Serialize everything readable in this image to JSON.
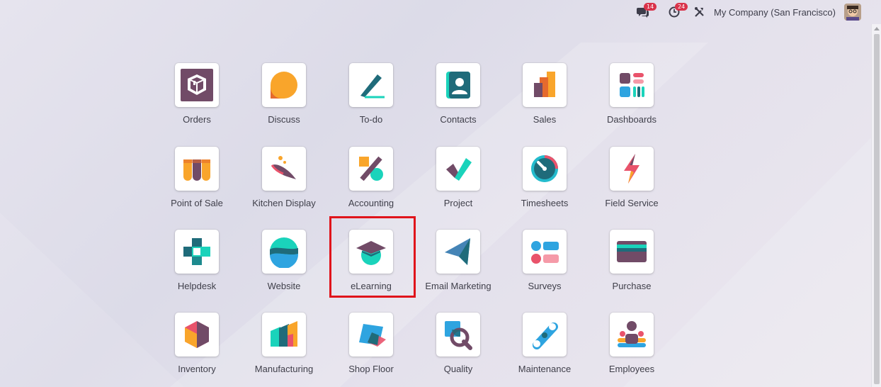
{
  "topbar": {
    "chat_badge": "14",
    "activity_badge": "24",
    "company_name": "My Company (San Francisco)",
    "icons": [
      "chat-icon",
      "activity-clock-icon",
      "debug-tools-icon",
      "user-avatar"
    ]
  },
  "apps": [
    {
      "label": "Orders",
      "icon": "orders-icon"
    },
    {
      "label": "Discuss",
      "icon": "discuss-icon"
    },
    {
      "label": "To-do",
      "icon": "todo-icon"
    },
    {
      "label": "Contacts",
      "icon": "contacts-icon"
    },
    {
      "label": "Sales",
      "icon": "sales-icon"
    },
    {
      "label": "Dashboards",
      "icon": "dashboards-icon"
    },
    {
      "label": "Point of Sale",
      "icon": "point-of-sale-icon"
    },
    {
      "label": "Kitchen Display",
      "icon": "kitchen-display-icon"
    },
    {
      "label": "Accounting",
      "icon": "accounting-icon"
    },
    {
      "label": "Project",
      "icon": "project-icon"
    },
    {
      "label": "Timesheets",
      "icon": "timesheets-icon"
    },
    {
      "label": "Field Service",
      "icon": "field-service-icon"
    },
    {
      "label": "Helpdesk",
      "icon": "helpdesk-icon"
    },
    {
      "label": "Website",
      "icon": "website-icon"
    },
    {
      "label": "eLearning",
      "icon": "elearning-icon"
    },
    {
      "label": "Email Marketing",
      "icon": "email-marketing-icon"
    },
    {
      "label": "Surveys",
      "icon": "surveys-icon"
    },
    {
      "label": "Purchase",
      "icon": "purchase-icon"
    },
    {
      "label": "Inventory",
      "icon": "inventory-icon"
    },
    {
      "label": "Manufacturing",
      "icon": "manufacturing-icon"
    },
    {
      "label": "Shop Floor",
      "icon": "shop-floor-icon"
    },
    {
      "label": "Quality",
      "icon": "quality-icon"
    },
    {
      "label": "Maintenance",
      "icon": "maintenance-icon"
    },
    {
      "label": "Employees",
      "icon": "employees-icon"
    }
  ],
  "highlighted_app": "eLearning",
  "colors": {
    "highlight": "#e0141b",
    "badge": "#d9334a",
    "purple": "#714b67",
    "teal": "#1ad3bb",
    "orange": "#f9a52b",
    "blue": "#2ea4e0"
  }
}
